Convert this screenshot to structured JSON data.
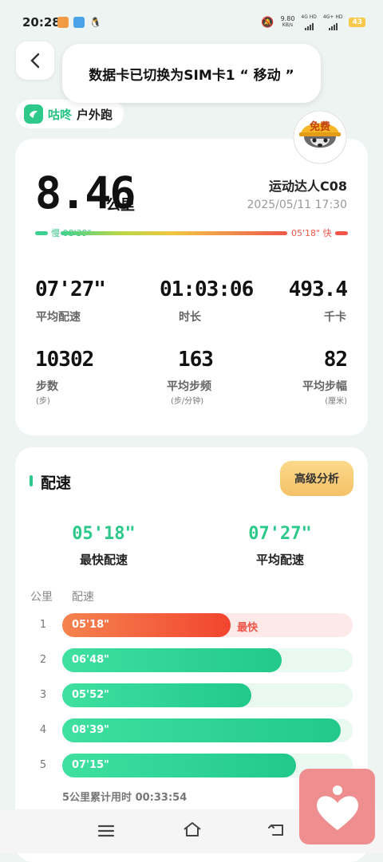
{
  "status": {
    "time": "20:28",
    "net_speed": "9.80",
    "net_unit": "KB/s",
    "sig1": "4G HD",
    "sig2": "4G+ HD",
    "battery": "43"
  },
  "toast": {
    "text": "数据卡已切换为SIM卡1 “ 移动 ”"
  },
  "brand": {
    "name": "咕咚",
    "subtitle": "户外跑",
    "avatar_badge": "免费"
  },
  "summary": {
    "distance": "8.46",
    "distance_unit": "公里",
    "user": "运动达人C08",
    "datetime": "2025/05/11 17:30",
    "slow_label": "慢 08'39\"",
    "fast_label": "05'18\" 快"
  },
  "stats": [
    {
      "value": "07'27\"",
      "label": "平均配速",
      "sub": ""
    },
    {
      "value": "01:03:06",
      "label": "时长",
      "sub": ""
    },
    {
      "value": "493.4",
      "label": "千卡",
      "sub": ""
    },
    {
      "value": "10302",
      "label": "步数",
      "sub": "(步)"
    },
    {
      "value": "163",
      "label": "平均步频",
      "sub": "(步/分钟)"
    },
    {
      "value": "82",
      "label": "平均步幅",
      "sub": "(厘米)"
    }
  ],
  "pace_section": {
    "title": "配速",
    "adv_button": "高级分析",
    "fastest_value": "05'18\"",
    "fastest_label": "最快配速",
    "avg_value": "07'27\"",
    "avg_label": "平均配速",
    "col_km": "公里",
    "col_pace": "配速",
    "fast_tag": "最快",
    "total": "5公里累计用时 00:33:54",
    "rows": [
      {
        "km": "1",
        "pace": "05'18\"",
        "seconds": 318,
        "fastest": true
      },
      {
        "km": "2",
        "pace": "06'48\"",
        "seconds": 408,
        "fastest": false
      },
      {
        "km": "3",
        "pace": "05'52\"",
        "seconds": 352,
        "fastest": false
      },
      {
        "km": "4",
        "pace": "08'39\"",
        "seconds": 519,
        "fastest": false
      },
      {
        "km": "5",
        "pace": "07'15\"",
        "seconds": 435,
        "fastest": false
      }
    ]
  },
  "colors": {
    "accent": "#2cc98a",
    "fast": "#f0574a",
    "gold": "#f5c168"
  },
  "icons": [
    "back-icon",
    "brand-logo-icon",
    "menu-icon",
    "home-icon",
    "return-icon",
    "heart-app-icon"
  ]
}
